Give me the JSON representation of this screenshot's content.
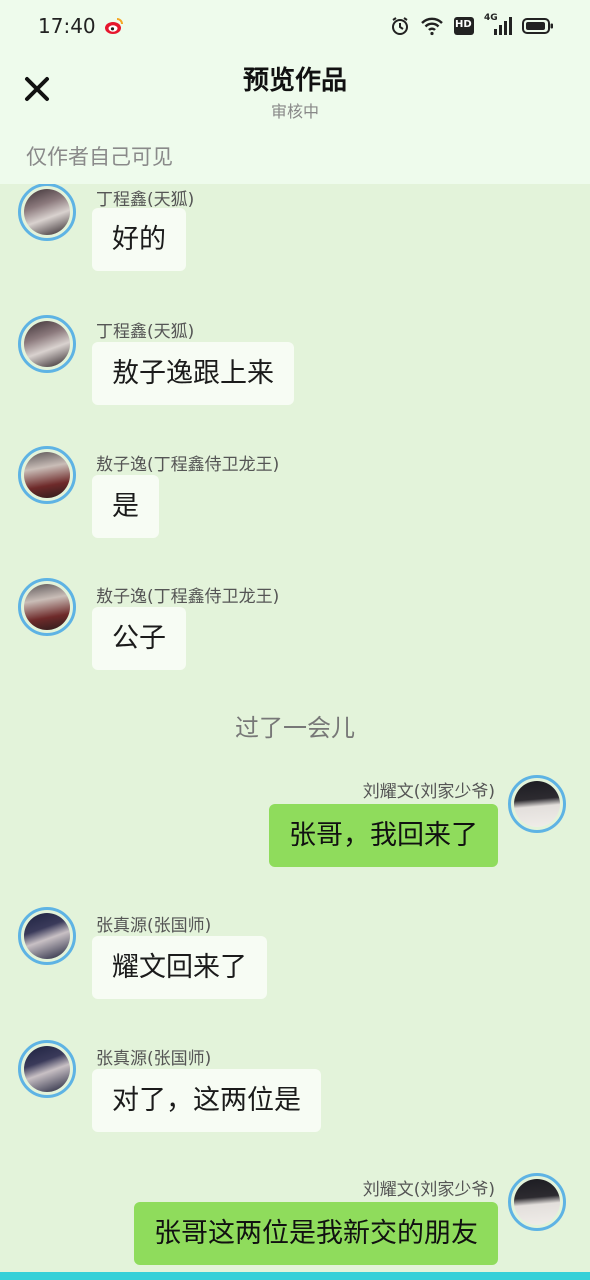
{
  "status_bar": {
    "time": "17:40",
    "icons": [
      "weibo-icon",
      "alarm-icon",
      "wifi-icon",
      "hd-icon",
      "signal-4g-icon",
      "battery-icon"
    ],
    "network_label": "4G",
    "hd_label": "HD"
  },
  "header": {
    "title": "预览作品",
    "subtitle": "审核中",
    "visibility_note": "仅作者自己可见"
  },
  "colors": {
    "background": "#e3f3da",
    "header_bg": "#eefbec",
    "left_bubble": "#f7fcf4",
    "right_bubble": "#8fdc5c",
    "avatar_ring": "#5eb3e4"
  },
  "messages": [
    {
      "side": "left",
      "name": "丁程鑫(天狐)",
      "text": "好的",
      "avatar": "avatar-dingchengxin"
    },
    {
      "side": "left",
      "name": "丁程鑫(天狐)",
      "text": "敖子逸跟上来",
      "avatar": "avatar-dingchengxin"
    },
    {
      "side": "left",
      "name": "敖子逸(丁程鑫侍卫龙王)",
      "text": "是",
      "avatar": "avatar-aoziyi"
    },
    {
      "side": "left",
      "name": "敖子逸(丁程鑫侍卫龙王)",
      "text": "公子",
      "avatar": "avatar-aoziyi"
    },
    {
      "side": "narration",
      "text": "过了一会儿"
    },
    {
      "side": "right",
      "name": "刘耀文(刘家少爷)",
      "text": "张哥，我回来了",
      "avatar": "avatar-liuyaowen"
    },
    {
      "side": "left",
      "name": "张真源(张国师)",
      "text": "耀文回来了",
      "avatar": "avatar-zhangzhenyuan"
    },
    {
      "side": "left",
      "name": "张真源(张国师)",
      "text": "对了，这两位是",
      "avatar": "avatar-zhangzhenyuan"
    },
    {
      "side": "right",
      "name": "刘耀文(刘家少爷)",
      "text": "张哥这两位是我新交的朋友",
      "avatar": "avatar-liuyaowen"
    }
  ]
}
